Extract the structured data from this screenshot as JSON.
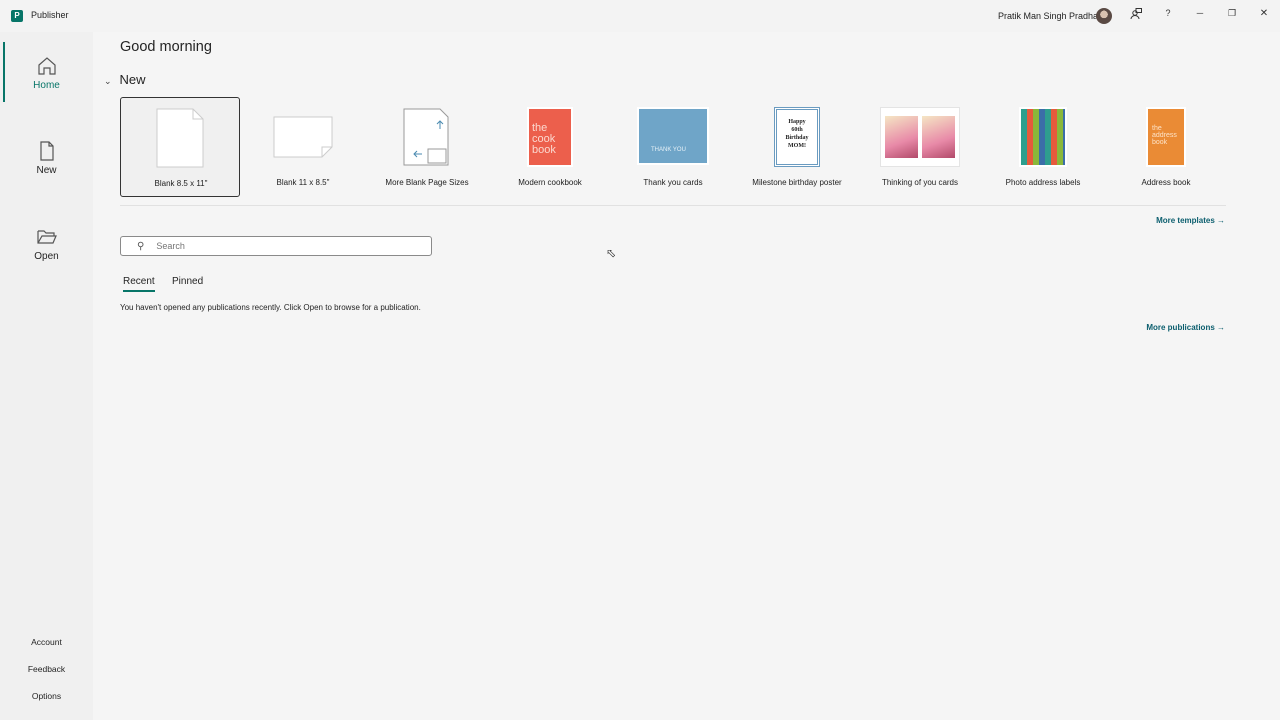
{
  "app": {
    "title": "Publisher",
    "logo_letter": "P",
    "user": "Pratik Man Singh Pradhan"
  },
  "titlebar": {
    "feedback_icon": "person-feedback-icon",
    "help": "?",
    "minimize": "─",
    "restore": "❐",
    "close": "✕"
  },
  "sidebar": {
    "items": [
      {
        "label": "Home"
      },
      {
        "label": "New"
      },
      {
        "label": "Open"
      }
    ],
    "bottom": [
      {
        "label": "Account"
      },
      {
        "label": "Feedback"
      },
      {
        "label": "Options"
      }
    ]
  },
  "main": {
    "greeting": "Good morning",
    "new_header": "New",
    "templates": [
      {
        "label": "Blank 8.5 x 11\""
      },
      {
        "label": "Blank 11 x 8.5\""
      },
      {
        "label": "More Blank Page Sizes"
      },
      {
        "label": "Modern cookbook",
        "art": "the cook book"
      },
      {
        "label": "Thank you cards",
        "art": "THANK YOU"
      },
      {
        "label": "Milestone birthday poster",
        "art": "Happy 60th Birthday MOM!"
      },
      {
        "label": "Thinking of you cards"
      },
      {
        "label": "Photo address labels"
      },
      {
        "label": "Address book",
        "art": "the address book"
      }
    ],
    "more_templates": "More templates →",
    "search_placeholder": "Search",
    "tabs": [
      {
        "label": "Recent"
      },
      {
        "label": "Pinned"
      }
    ],
    "empty_message": "You haven't opened any publications recently. Click Open to browse for a publication.",
    "more_publications": "More publications →"
  }
}
